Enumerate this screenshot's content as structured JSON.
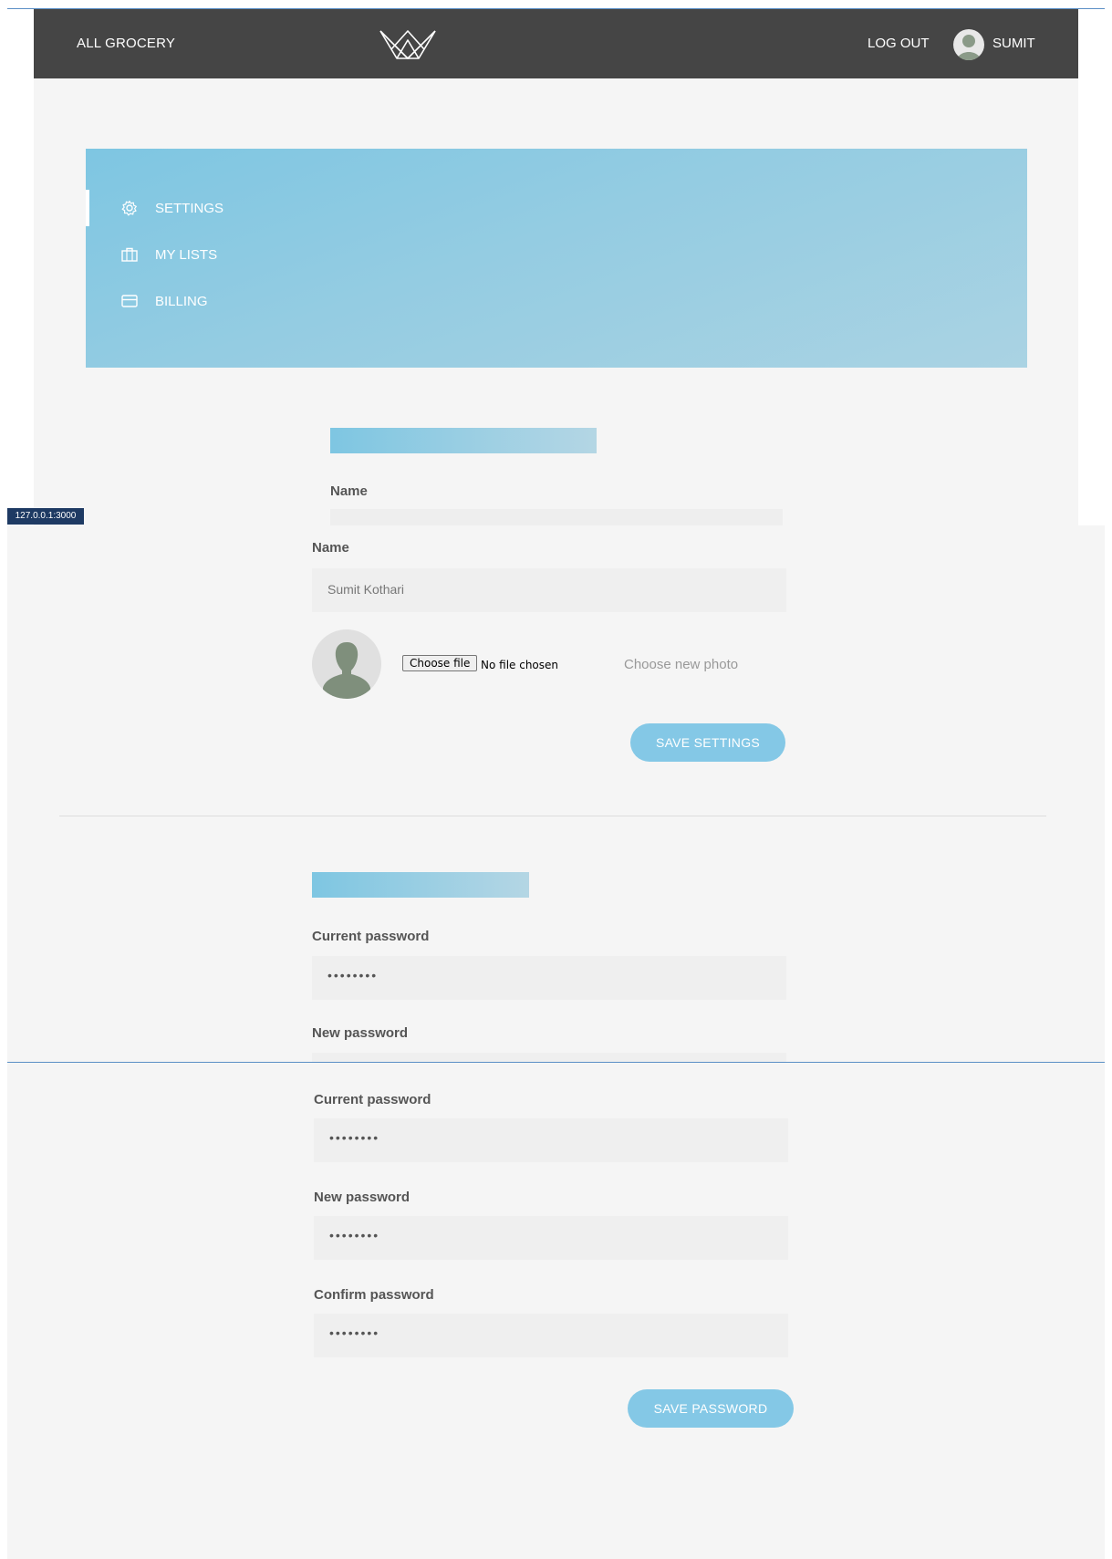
{
  "header": {
    "brand": "ALL GROCERY",
    "logo": "crown-logo",
    "logout": "LOG OUT",
    "username": "SUMIT"
  },
  "sidebar": {
    "items": [
      {
        "label": "SETTINGS",
        "icon": "gear-icon",
        "active": true
      },
      {
        "label": "MY LISTS",
        "icon": "briefcase-icon",
        "active": false
      },
      {
        "label": "BILLING",
        "icon": "credit-card-icon",
        "active": false
      }
    ]
  },
  "url_tooltip": "127.0.0.1:3000",
  "profile": {
    "name_label": "Name",
    "name_value": "Sumit Kothari",
    "file_button": "Choose file",
    "file_status": "No file chosen",
    "photo_hint": "Choose new photo",
    "save_button": "SAVE SETTINGS"
  },
  "password": {
    "current_label": "Current password",
    "current_value": "••••••••",
    "new_label": "New password",
    "new_value": "••••••••",
    "confirm_label": "Confirm password",
    "confirm_value": "••••••••",
    "save_button": "SAVE PASSWORD"
  },
  "colors": {
    "navbar": "#454545",
    "accent": "#7ec6e2",
    "button": "#84c8e6",
    "background": "#f5f5f5"
  }
}
